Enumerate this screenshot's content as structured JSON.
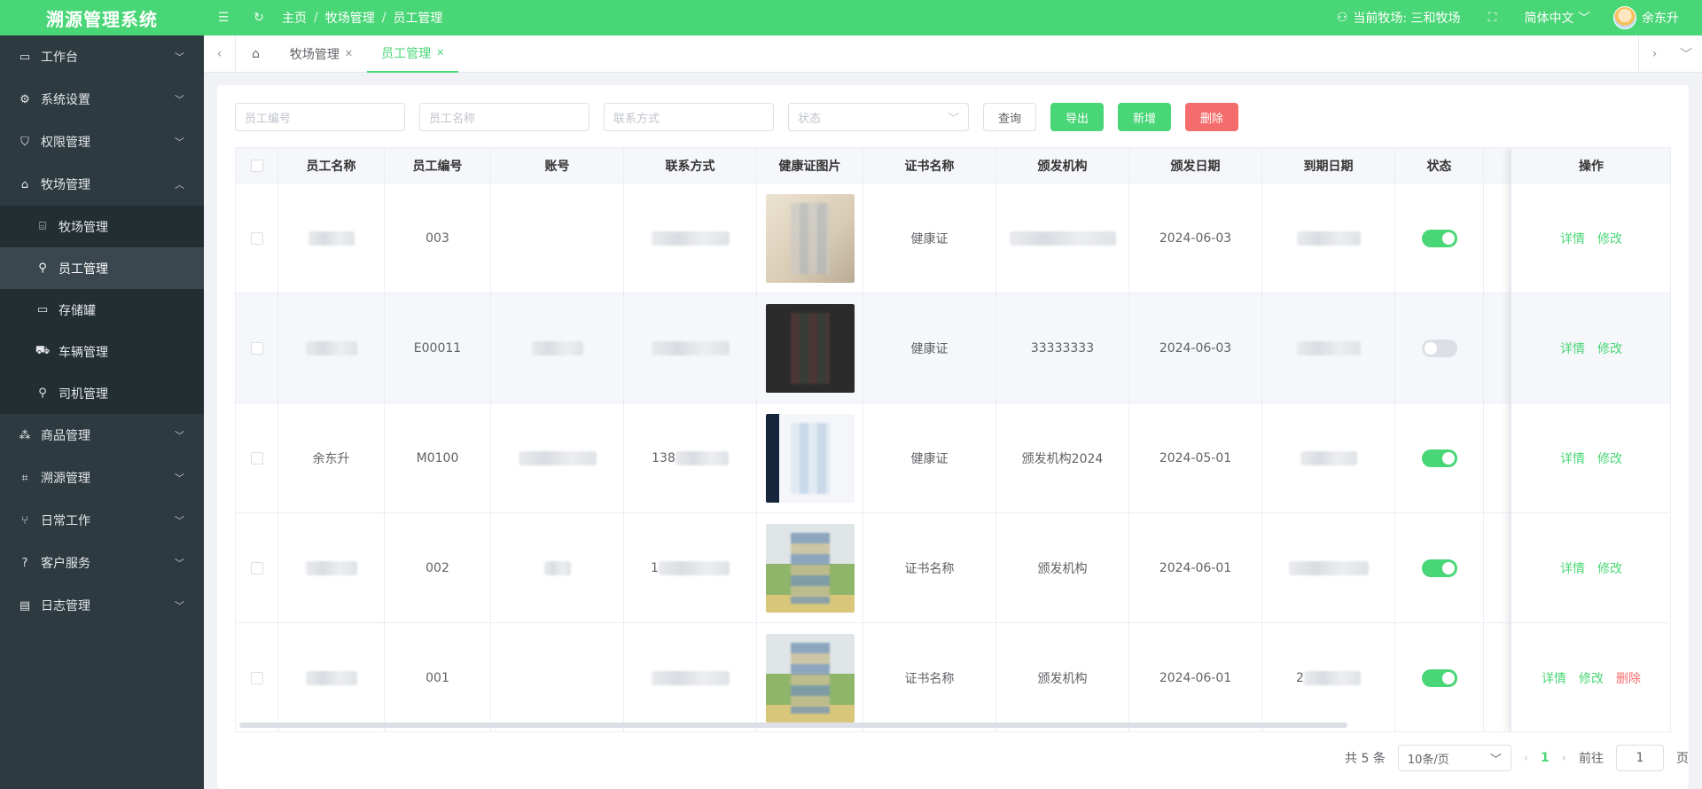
{
  "header": {
    "brand": "溯源管理系统",
    "breadcrumb": [
      "主页",
      "牧场管理",
      "员工管理"
    ],
    "current_farm": "当前牧场: 三和牧场",
    "language": "简体中文",
    "user_name": "余东升",
    "accent_color": "#49d676"
  },
  "sidebar": {
    "items": [
      {
        "label": "工作台",
        "icon": "monitor-icon",
        "arrow": "﹀"
      },
      {
        "label": "系统设置",
        "icon": "gear-icon",
        "arrow": "﹀"
      },
      {
        "label": "权限管理",
        "icon": "shield-icon",
        "arrow": "﹀"
      },
      {
        "label": "牧场管理",
        "icon": "home-icon",
        "arrow": "︿"
      }
    ],
    "sub_items": [
      {
        "label": "牧场管理",
        "icon": "bank-icon"
      },
      {
        "label": "员工管理",
        "icon": "user-icon"
      },
      {
        "label": "存储罐",
        "icon": "box-icon"
      },
      {
        "label": "车辆管理",
        "icon": "car-icon"
      },
      {
        "label": "司机管理",
        "icon": "user-icon"
      }
    ],
    "items_after": [
      {
        "label": "商品管理",
        "icon": "cluster-icon",
        "arrow": "﹀"
      },
      {
        "label": "溯源管理",
        "icon": "scan-icon",
        "arrow": "﹀"
      },
      {
        "label": "日常工作",
        "icon": "tree-icon",
        "arrow": "﹀"
      },
      {
        "label": "客户服务",
        "icon": "question-icon",
        "arrow": "﹀"
      },
      {
        "label": "日志管理",
        "icon": "document-icon",
        "arrow": "﹀"
      }
    ]
  },
  "tabs": [
    {
      "label": "牧场管理",
      "close": "✕"
    },
    {
      "label": "员工管理",
      "close": "✕"
    }
  ],
  "filters": {
    "employee_no_placeholder": "员工编号",
    "employee_name_placeholder": "员工名称",
    "contact_placeholder": "联系方式",
    "status_placeholder": "状态",
    "query_label": "查询",
    "export_label": "导出",
    "add_label": "新增",
    "delete_label": "删除"
  },
  "table": {
    "columns": [
      "员工名称",
      "员工编号",
      "账号",
      "联系方式",
      "健康证图片",
      "证书名称",
      "颁发机构",
      "颁发日期",
      "到期日期",
      "状态",
      "操作"
    ],
    "rows": [
      {
        "name": "",
        "no": "003",
        "account": "",
        "contact": "",
        "cert": "健康证",
        "issuer": "",
        "issue_date": "2024-06-03",
        "expire": "",
        "status": "on",
        "ops": [
          "详情",
          "修改"
        ]
      },
      {
        "name": "",
        "no": "E00011",
        "account": "",
        "contact": "",
        "cert": "健康证",
        "issuer": "33333333",
        "issue_date": "2024-06-03",
        "expire": "",
        "status": "off",
        "ops": [
          "详情",
          "修改"
        ]
      },
      {
        "name": "余东升",
        "no": "M0100",
        "account": "",
        "contact": "138",
        "cert": "健康证",
        "issuer": "颁发机构2024",
        "issue_date": "2024-05-01",
        "expire": "",
        "status": "on",
        "ops": [
          "详情",
          "修改"
        ]
      },
      {
        "name": "",
        "no": "002",
        "account": "",
        "contact": "1",
        "cert": "证书名称",
        "issuer": "颁发机构",
        "issue_date": "2024-06-01",
        "expire": "",
        "status": "on",
        "ops": [
          "详情",
          "修改"
        ]
      },
      {
        "name": "",
        "no": "001",
        "account": "",
        "contact": "",
        "cert": "证书名称",
        "issuer": "颁发机构",
        "issue_date": "2024-06-01",
        "expire": "2",
        "status": "on",
        "ops": [
          "详情",
          "修改",
          "删除"
        ]
      }
    ]
  },
  "pagination": {
    "total": "共 5 条",
    "page_size": "10条/页",
    "current_page": "1",
    "goto_label": "前往",
    "goto_value": "1",
    "page_suffix": "页"
  }
}
